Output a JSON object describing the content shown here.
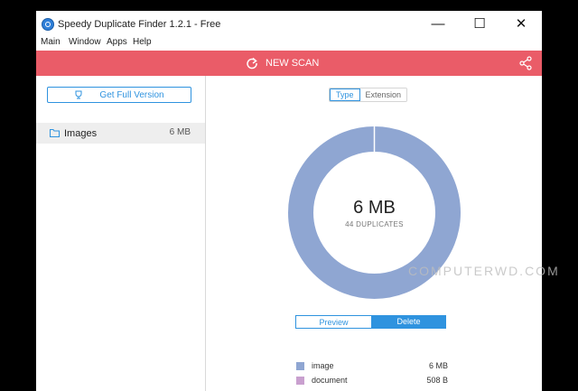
{
  "window": {
    "title": "Speedy Duplicate Finder 1.2.1 - Free",
    "controls": [
      "minimize",
      "maximize",
      "close"
    ]
  },
  "menu": {
    "items": [
      "Main",
      "Window",
      "Apps",
      "Help"
    ]
  },
  "toolbar": {
    "new_scan_label": "NEW SCAN",
    "refresh_icon": "refresh-icon",
    "share_icon": "share-icon",
    "accent_color": "#ea5c68"
  },
  "sidebar": {
    "full_version_label": "Get Full Version",
    "trophy_icon": "trophy-icon",
    "folders": [
      {
        "name": "Images",
        "size": "6 MB",
        "icon": "folder-icon"
      }
    ]
  },
  "main": {
    "view_toggle": [
      "Type",
      "Extension"
    ],
    "selected_view": "Type",
    "total_size": "6 MB",
    "duplicates_label": "44 DUPLICATES",
    "preview_label": "Preview",
    "delete_label": "Delete",
    "donut": [
      {
        "label": "image",
        "color": "#8fa6d2",
        "value": "6 MB"
      },
      {
        "label": "document",
        "color": "#c9a0cf",
        "value": "508 B"
      }
    ]
  },
  "watermark": "COMPUTERWD.COM"
}
